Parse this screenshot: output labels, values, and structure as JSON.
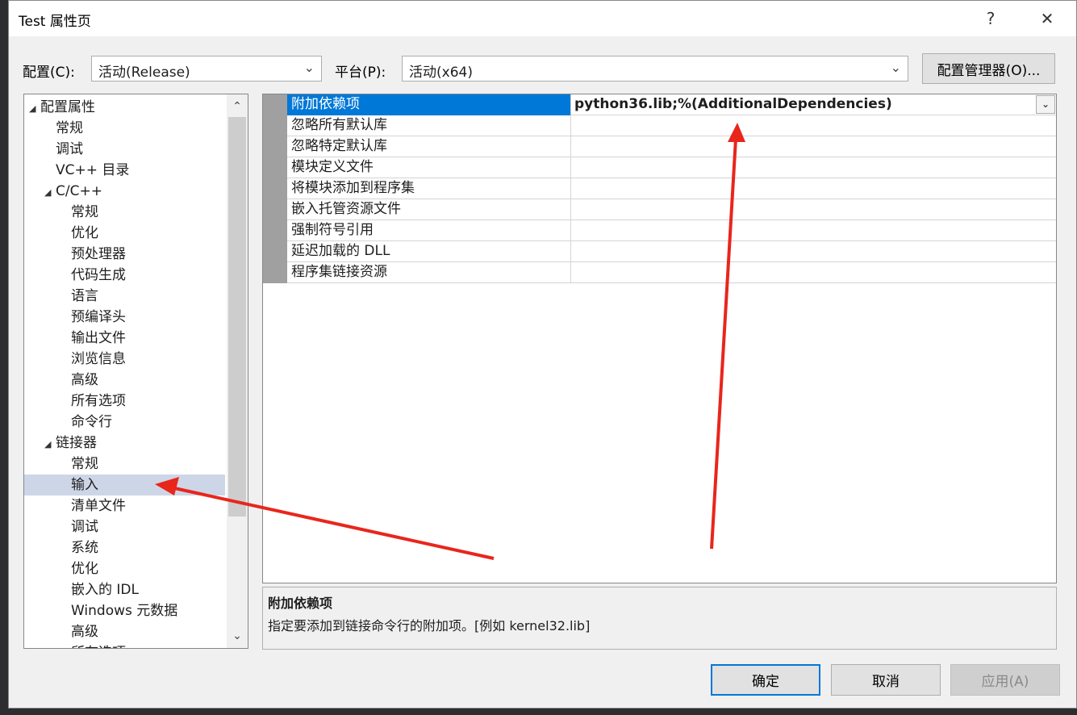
{
  "window": {
    "title": "Test 属性页",
    "help": "?",
    "close": "✕"
  },
  "config": {
    "label": "配置(C):",
    "value": "活动(Release)"
  },
  "platform": {
    "label": "平台(P):",
    "value": "活动(x64)"
  },
  "config_manager_btn": "配置管理器(O)...",
  "tree": [
    {
      "label": "配置属性",
      "level": 0,
      "expanded": true
    },
    {
      "label": "常规",
      "level": 1
    },
    {
      "label": "调试",
      "level": 1
    },
    {
      "label": "VC++ 目录",
      "level": 1
    },
    {
      "label": "C/C++",
      "level": 1,
      "expanded": true
    },
    {
      "label": "常规",
      "level": 2
    },
    {
      "label": "优化",
      "level": 2
    },
    {
      "label": "预处理器",
      "level": 2
    },
    {
      "label": "代码生成",
      "level": 2
    },
    {
      "label": "语言",
      "level": 2
    },
    {
      "label": "预编译头",
      "level": 2
    },
    {
      "label": "输出文件",
      "level": 2
    },
    {
      "label": "浏览信息",
      "level": 2
    },
    {
      "label": "高级",
      "level": 2
    },
    {
      "label": "所有选项",
      "level": 2
    },
    {
      "label": "命令行",
      "level": 2
    },
    {
      "label": "链接器",
      "level": 1,
      "expanded": true
    },
    {
      "label": "常规",
      "level": 2
    },
    {
      "label": "输入",
      "level": 2,
      "selected": true
    },
    {
      "label": "清单文件",
      "level": 2
    },
    {
      "label": "调试",
      "level": 2
    },
    {
      "label": "系统",
      "level": 2
    },
    {
      "label": "优化",
      "level": 2
    },
    {
      "label": "嵌入的 IDL",
      "level": 2
    },
    {
      "label": "Windows 元数据",
      "level": 2
    },
    {
      "label": "高级",
      "level": 2
    },
    {
      "label": "所有选项",
      "level": 2
    }
  ],
  "properties": [
    {
      "name": "附加依赖项",
      "value": "python36.lib;%(AdditionalDependencies)",
      "selected": true
    },
    {
      "name": "忽略所有默认库",
      "value": ""
    },
    {
      "name": "忽略特定默认库",
      "value": ""
    },
    {
      "name": "模块定义文件",
      "value": ""
    },
    {
      "name": "将模块添加到程序集",
      "value": ""
    },
    {
      "name": "嵌入托管资源文件",
      "value": ""
    },
    {
      "name": "强制符号引用",
      "value": ""
    },
    {
      "name": "延迟加载的 DLL",
      "value": ""
    },
    {
      "name": "程序集链接资源",
      "value": ""
    }
  ],
  "description": {
    "title": "附加依赖项",
    "text": "指定要添加到链接命令行的附加项。[例如 kernel32.lib]"
  },
  "buttons": {
    "ok": "确定",
    "cancel": "取消",
    "apply": "应用(A)"
  },
  "colors": {
    "selection": "#0078d7",
    "annotation": "#e8261c"
  }
}
